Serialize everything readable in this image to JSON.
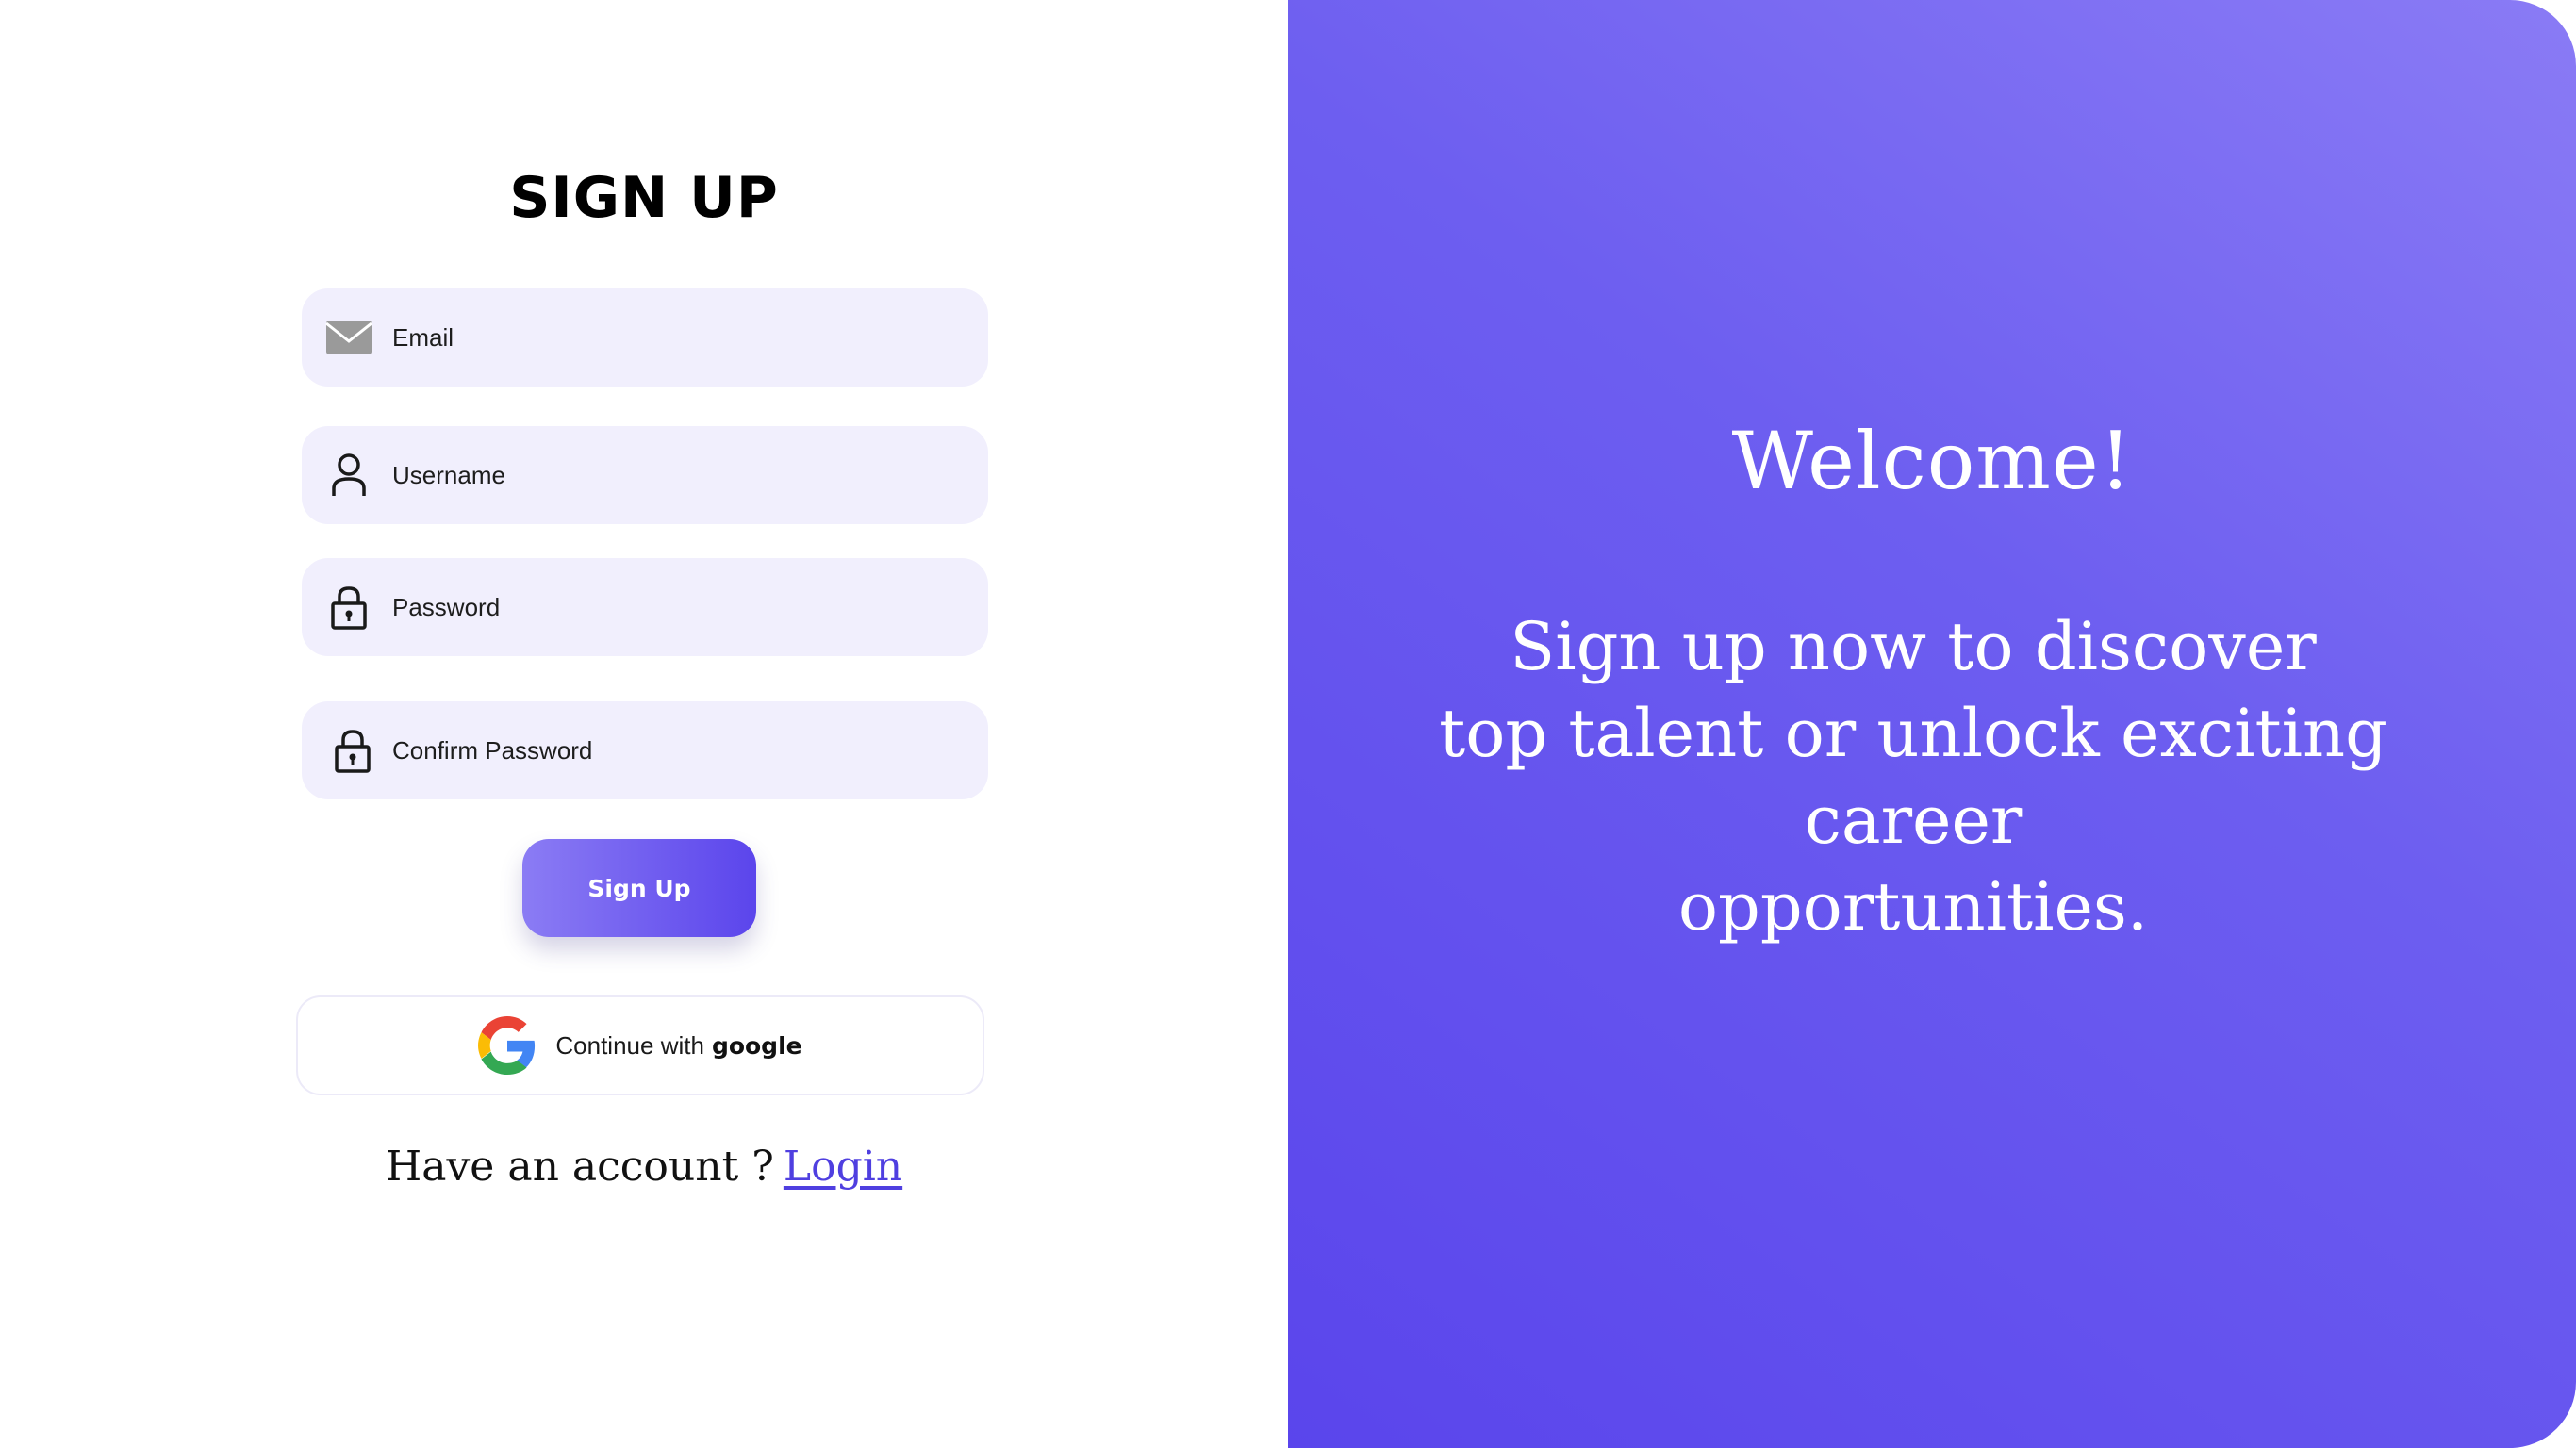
{
  "signup": {
    "title": "SIGN UP",
    "fields": {
      "email": {
        "placeholder": "Email",
        "icon": "envelope-icon"
      },
      "username": {
        "placeholder": "Username",
        "icon": "user-icon"
      },
      "password": {
        "placeholder": "Password",
        "icon": "lock-icon"
      },
      "confirm_password": {
        "placeholder": "Confirm Password",
        "icon": "lock-icon"
      }
    },
    "submit_label": "Sign Up",
    "google": {
      "prefix": "Continue with",
      "brand": "google",
      "icon": "google-icon"
    },
    "footer": {
      "text": "Have an account",
      "question_mark": "?",
      "login_label": "Login"
    }
  },
  "welcome_panel": {
    "heading": "Welcome!",
    "lines": [
      "Sign up now to discover",
      "top talent or unlock exciting career",
      "opportunities."
    ]
  },
  "colors": {
    "accent": "#5b45ec",
    "accent_light": "#8b7cf4",
    "field_bg": "#f1effd",
    "link": "#4f3fe0"
  }
}
